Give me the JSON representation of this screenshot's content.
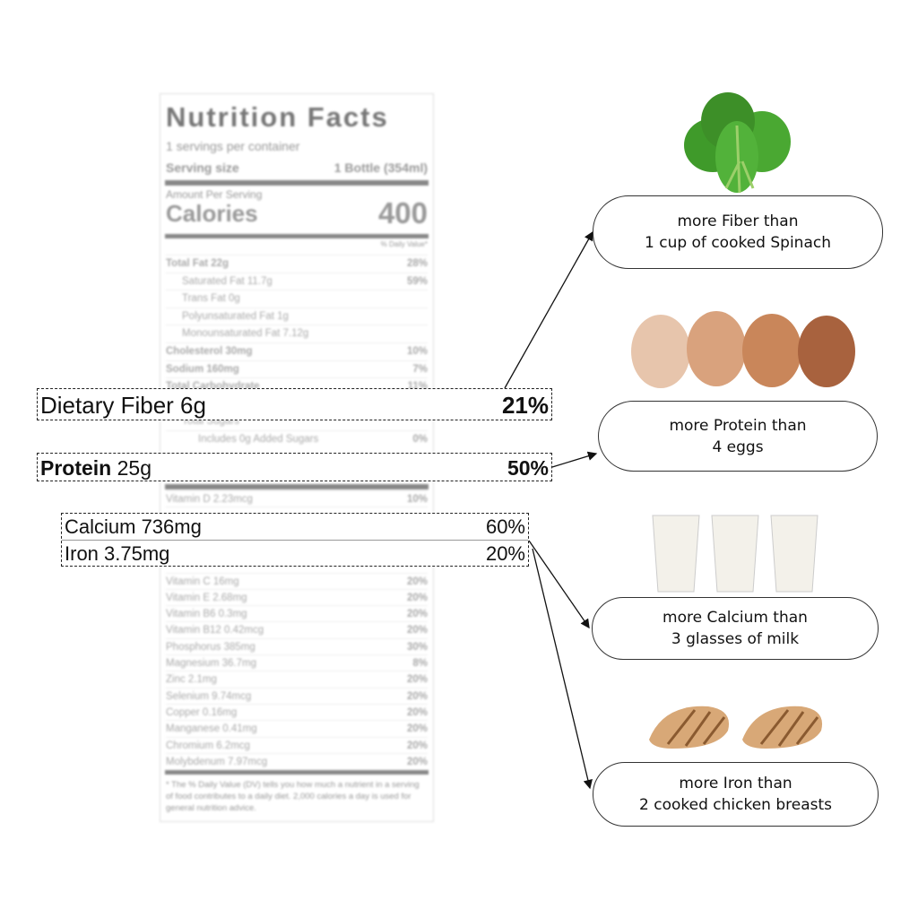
{
  "label": {
    "title": "Nutrition Facts",
    "servings": "1 servings per container",
    "serving_size_label": "Serving size",
    "serving_size_value": "1 Bottle (354ml)",
    "amount_per_serving": "Amount Per Serving",
    "calories_label": "Calories",
    "calories_value": "400",
    "daily_value_header": "% Daily Value*",
    "rows_top": [
      {
        "name": "Total Fat 22g",
        "pct": "28%",
        "bold": true
      },
      {
        "name": "Saturated Fat 11.7g",
        "pct": "59%",
        "indent": 1
      },
      {
        "name": "Trans Fat 0g",
        "pct": "",
        "indent": 1
      },
      {
        "name": "Polyunsaturated Fat 1g",
        "pct": "",
        "indent": 1
      },
      {
        "name": "Monounsaturated Fat 7.12g",
        "pct": "",
        "indent": 1
      },
      {
        "name": "Cholesterol 30mg",
        "pct": "10%",
        "bold": true
      },
      {
        "name": "Sodium 160mg",
        "pct": "7%",
        "bold": true
      },
      {
        "name": "Total Carbohydrate",
        "pct": "11%",
        "bold": true
      },
      {
        "name": "",
        "pct": ""
      },
      {
        "name": "Total Sugars",
        "pct": "",
        "indent": 1
      },
      {
        "name": "Includes 0g Added Sugars",
        "pct": "0%",
        "indent": 2
      }
    ],
    "rows_bottom": [
      {
        "name": "Vitamin D 2.23mcg",
        "pct": "10%"
      },
      {
        "name": "",
        "pct": ""
      },
      {
        "name": "",
        "pct": ""
      },
      {
        "name": "",
        "pct": ""
      },
      {
        "name": "",
        "pct": ""
      },
      {
        "name": "Vitamin C 16mg",
        "pct": "20%"
      },
      {
        "name": "Vitamin E 2.68mg",
        "pct": "20%"
      },
      {
        "name": "Vitamin B6 0.3mg",
        "pct": "20%"
      },
      {
        "name": "Vitamin B12 0.42mcg",
        "pct": "20%"
      },
      {
        "name": "Phosphorus 385mg",
        "pct": "30%"
      },
      {
        "name": "Magnesium 36.7mg",
        "pct": "8%"
      },
      {
        "name": "Zinc 2.1mg",
        "pct": "20%"
      },
      {
        "name": "Selenium 9.74mcg",
        "pct": "20%"
      },
      {
        "name": "Copper 0.16mg",
        "pct": "20%"
      },
      {
        "name": "Manganese 0.41mg",
        "pct": "20%"
      },
      {
        "name": "Chromium 6.2mcg",
        "pct": "20%"
      },
      {
        "name": "Molybdenum 7.97mcg",
        "pct": "20%"
      }
    ],
    "footnote": "* The % Daily Value (DV) tells you how much a nutrient in a serving of food contributes to a daily diet. 2,000 calories a day is used for general nutrition advice."
  },
  "highlights": {
    "fiber": {
      "label": "Dietary Fiber 6g",
      "pct": "21%"
    },
    "protein": {
      "label_bold": "Protein",
      "label_rest": " 25g",
      "pct": "50%"
    },
    "calcium": {
      "label": "Calcium 736mg",
      "pct": "60%"
    },
    "iron": {
      "label": "Iron 3.75mg",
      "pct": "20%"
    }
  },
  "comparisons": [
    {
      "line1": "more Fiber than",
      "line2": "1 cup of cooked Spinach",
      "image": "spinach"
    },
    {
      "line1": "more Protein than",
      "line2": "4 eggs",
      "image": "eggs"
    },
    {
      "line1": "more Calcium than",
      "line2": "3 glasses of milk",
      "image": "milk-glasses"
    },
    {
      "line1": "more Iron than",
      "line2": "2 cooked chicken breasts",
      "image": "chicken-breasts"
    }
  ]
}
